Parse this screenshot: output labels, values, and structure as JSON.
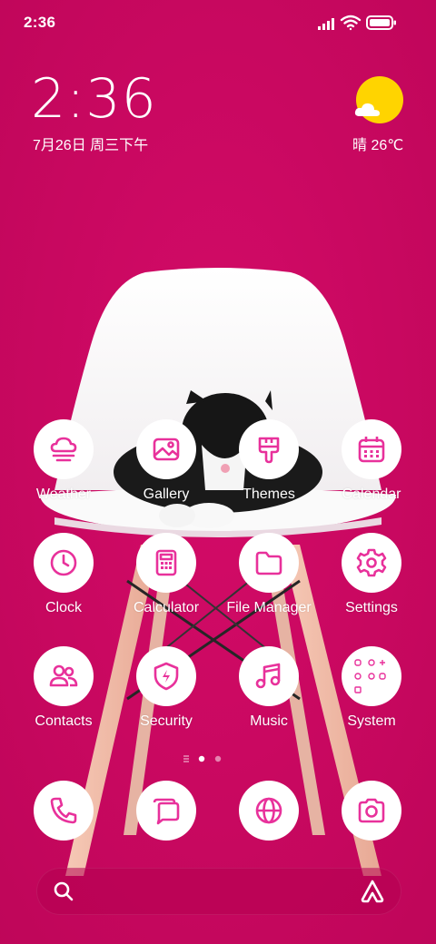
{
  "status_bar": {
    "time": "2:36"
  },
  "widget": {
    "time": "2:36",
    "date": "7月26日 周三下午",
    "weather": "晴 26℃"
  },
  "apps": [
    {
      "label": "Weather",
      "icon": "weather-icon"
    },
    {
      "label": "Gallery",
      "icon": "gallery-icon"
    },
    {
      "label": "Themes",
      "icon": "themes-icon"
    },
    {
      "label": "Calendar",
      "icon": "calendar-icon"
    },
    {
      "label": "Clock",
      "icon": "clock-icon"
    },
    {
      "label": "Calculator",
      "icon": "calculator-icon"
    },
    {
      "label": "File Manager",
      "icon": "folder-icon"
    },
    {
      "label": "Settings",
      "icon": "gear-icon"
    },
    {
      "label": "Contacts",
      "icon": "contacts-icon"
    },
    {
      "label": "Security",
      "icon": "shield-icon"
    },
    {
      "label": "Music",
      "icon": "music-icon"
    },
    {
      "label": "System",
      "icon": "system-folder-icon"
    }
  ],
  "dock": [
    {
      "icon": "phone-icon"
    },
    {
      "icon": "messages-icon"
    },
    {
      "icon": "browser-icon"
    },
    {
      "icon": "camera-icon"
    }
  ],
  "page_indicator": {
    "pages": 2,
    "current": 1
  },
  "colors": {
    "accent": "#e8319b",
    "background": "#c8075f",
    "sun": "#ffd400"
  }
}
